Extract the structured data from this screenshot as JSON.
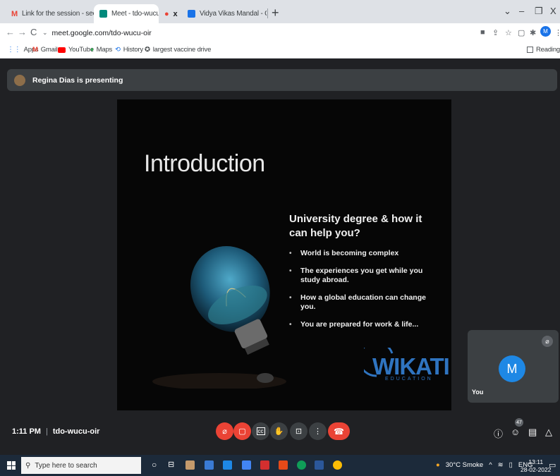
{
  "browser": {
    "tabs": [
      {
        "title": "Link for the session - seema.dha",
        "favicon": "gmail-icon",
        "color": "#ea4335"
      },
      {
        "title": "Meet - tdo-wucu-oir",
        "favicon": "meet-icon",
        "color": "#00897b"
      },
      {
        "title": "",
        "favicon": "recording-icon",
        "color": "#ea4335"
      },
      {
        "title": "Vidya Vikas Mandal - Calendar -",
        "favicon": "calendar-icon",
        "color": "#1a73e8"
      }
    ],
    "tab_close": "x",
    "new_tab": "+",
    "window": {
      "minimize": "–",
      "restore": "❐",
      "close": "X",
      "tab_search": "⌄"
    },
    "address": "meet.google.com/tdo-wucu-oir",
    "profile_initial": "M",
    "bookmarks": [
      {
        "label": "Apps",
        "icon": "apps-grid-icon"
      },
      {
        "label": "Gmail",
        "icon": "gmail-icon"
      },
      {
        "label": "YouTube",
        "icon": "youtube-icon"
      },
      {
        "label": "Maps",
        "icon": "maps-pin-icon"
      },
      {
        "label": "History",
        "icon": "history-icon"
      },
      {
        "label": "largest vaccine drive",
        "icon": "bookmark-icon"
      }
    ],
    "reading_list": "Reading list"
  },
  "meet": {
    "presenting_banner": "Regina Dias is presenting",
    "slide": {
      "title": "Introduction",
      "heading": "University degree & how it can help you?",
      "bullets": [
        "World is becoming complex",
        "The experiences you get while you study abroad.",
        "How a global education can change you.",
        "You are prepared for work & life..."
      ],
      "logo": "WIKATI",
      "logo_sub": "EDUCATION"
    },
    "self_tile": {
      "initial": "M",
      "label": "You"
    },
    "time": "1:11 PM",
    "separator": "|",
    "meeting_code": "tdo-wucu-oir",
    "participant_count": "47",
    "accent_red": "#ea4335"
  },
  "taskbar": {
    "search_placeholder": "Type here to search",
    "weather": "30°C Smoke",
    "language": "ENG",
    "clock_time": "13:11",
    "clock_date": "28-02-2022"
  }
}
